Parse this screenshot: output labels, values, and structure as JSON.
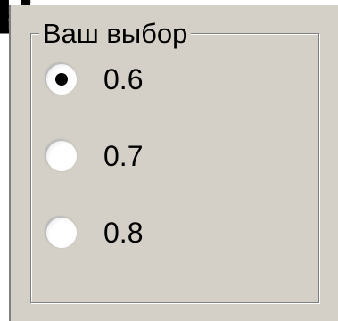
{
  "window_fragment": {
    "header_char": "р"
  },
  "group": {
    "title": "Ваш выбор"
  },
  "options": [
    {
      "label": "0.6",
      "selected": true
    },
    {
      "label": "0.7",
      "selected": false
    },
    {
      "label": "0.8",
      "selected": false
    }
  ],
  "colors": {
    "panel": "#d4d0c8",
    "border_dark": "#808080",
    "border_light": "#ffffff",
    "text": "#000000"
  }
}
